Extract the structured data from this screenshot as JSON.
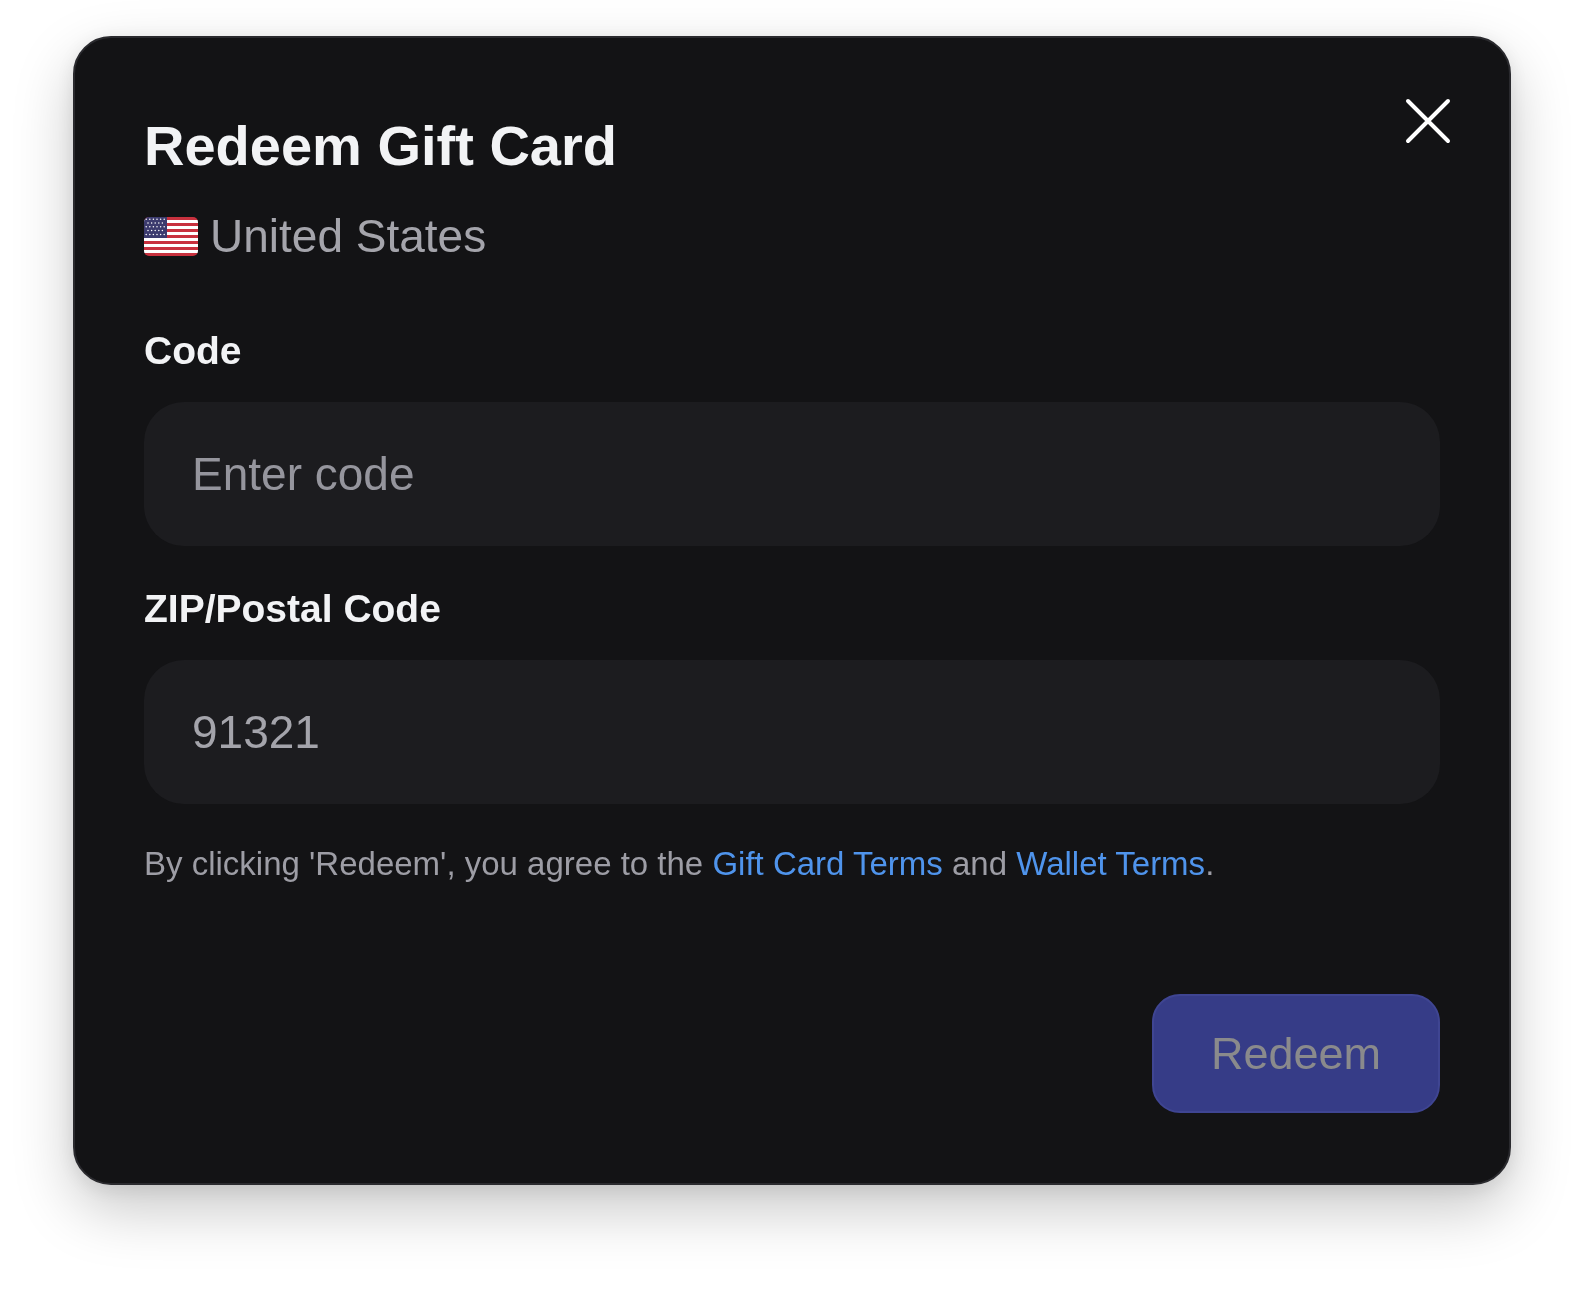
{
  "dialog": {
    "title": "Redeem Gift Card",
    "country": {
      "name": "United States"
    }
  },
  "fields": [
    {
      "label": "Code",
      "placeholder": "Enter code"
    },
    {
      "label": "ZIP/Postal Code",
      "value": "91321"
    }
  ],
  "terms": {
    "parts": [
      {
        "kind": "text",
        "text": "By clicking 'Redeem', you agree to the "
      },
      {
        "kind": "link",
        "text": "Gift Card Terms"
      },
      {
        "kind": "text",
        "text": " and "
      },
      {
        "kind": "link",
        "text": "Wallet Terms"
      },
      {
        "kind": "text",
        "text": "."
      }
    ]
  },
  "button": {
    "label": "Redeem",
    "disabled": true
  }
}
